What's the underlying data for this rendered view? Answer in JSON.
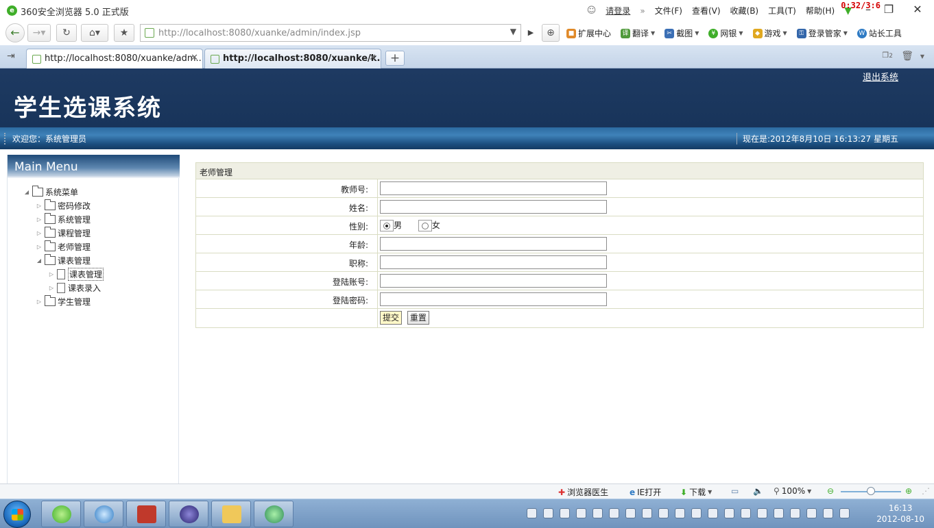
{
  "browser": {
    "title": "360安全浏览器 5.0 正式版",
    "login": "请登录",
    "menu": [
      "文件(F)",
      "查看(V)",
      "收藏(B)",
      "工具(T)",
      "帮助(H)"
    ],
    "timer": "0:32/3:6",
    "url": "http://localhost:8080/xuanke/admin/index.jsp",
    "toolbar": [
      {
        "label": "扩展中心",
        "icon": "cube-icon",
        "color": "#e08a2a"
      },
      {
        "label": "翻译",
        "icon": "translate-icon",
        "color": "#4f9a3a"
      },
      {
        "label": "截图",
        "icon": "screenshot-icon",
        "color": "#3b6fb5"
      },
      {
        "label": "网银",
        "icon": "bank-icon",
        "color": "#3fae29"
      },
      {
        "label": "游戏",
        "icon": "game-icon",
        "color": "#e0a820"
      },
      {
        "label": "登录管家",
        "icon": "key-icon",
        "color": "#3366aa"
      },
      {
        "label": "站长工具",
        "icon": "webmaster-icon",
        "color": "#2f7bc4"
      }
    ],
    "tabs": [
      {
        "label": "http://localhost:8080/xuanke/adm..."
      },
      {
        "label": "http://localhost:8080/xuanke/k..."
      }
    ],
    "tab_count": "2"
  },
  "page": {
    "site_title": "学生选课系统",
    "logout": "退出系统",
    "welcome": "欢迎您：系统管理员",
    "now": "现在是:2012年8月10日  16:13:27 星期五",
    "menu_title": "Main Menu",
    "tree": [
      {
        "label": "系统菜单",
        "level": 0,
        "icon": "folder-open-icon",
        "expanded": true
      },
      {
        "label": "密码修改",
        "level": 1,
        "icon": "folder-icon",
        "expanded": false
      },
      {
        "label": "系统管理",
        "level": 1,
        "icon": "folder-icon",
        "expanded": false
      },
      {
        "label": "课程管理",
        "level": 1,
        "icon": "folder-icon",
        "expanded": false
      },
      {
        "label": "老师管理",
        "level": 1,
        "icon": "folder-icon",
        "expanded": false
      },
      {
        "label": "课表管理",
        "level": 1,
        "icon": "folder-open-icon",
        "expanded": true
      },
      {
        "label": "课表管理",
        "level": 2,
        "icon": "document-icon",
        "expanded": false,
        "selected": true
      },
      {
        "label": "课表录入",
        "level": 2,
        "icon": "document-icon",
        "expanded": false
      },
      {
        "label": "学生管理",
        "level": 1,
        "icon": "folder-icon",
        "expanded": false
      }
    ],
    "section_title": "老师管理",
    "fields": {
      "teacher_no": {
        "label": "教师号:",
        "value": ""
      },
      "name": {
        "label": "姓名:",
        "value": ""
      },
      "gender": {
        "label": "性别:",
        "options": [
          "男",
          "女"
        ],
        "selected": "男"
      },
      "age": {
        "label": "年龄:",
        "value": ""
      },
      "title": {
        "label": "职称:",
        "value": ""
      },
      "account": {
        "label": "登陆账号:",
        "value": ""
      },
      "password": {
        "label": "登陆密码:",
        "value": ""
      }
    },
    "submit": "提交",
    "reset": "重置"
  },
  "statusbar": {
    "doctor": "浏览器医生",
    "ie_open": "IE打开",
    "download": "下载",
    "zoom": "100%"
  },
  "taskbar": {
    "time": "16:13",
    "date": "2012-08-10"
  }
}
